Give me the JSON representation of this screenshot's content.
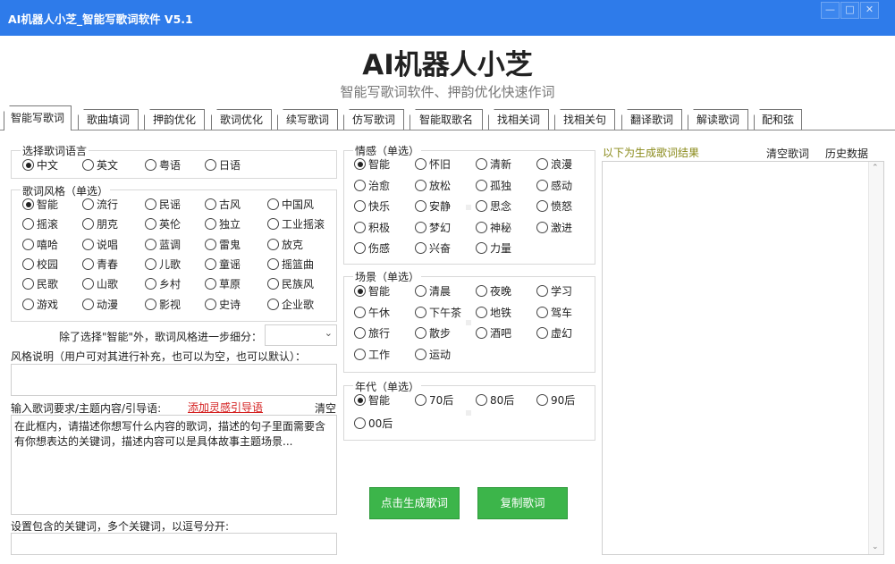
{
  "window": {
    "title": "AI机器人小芝_智能写歌词软件 V5.1",
    "min": "—",
    "max": "□",
    "close": "✕"
  },
  "header": {
    "title": "AI机器人小芝",
    "subtitle": "智能写歌词软件、押韵优化快速作词"
  },
  "tabs": [
    "智能写歌词",
    "歌曲填词",
    "押韵优化",
    "歌词优化",
    "续写歌词",
    "仿写歌词",
    "智能取歌名",
    "找相关词",
    "找相关句",
    "翻译歌词",
    "解读歌词",
    "配和弦"
  ],
  "language": {
    "label": "选择歌词语言",
    "options": [
      "中文",
      "英文",
      "粤语",
      "日语"
    ],
    "selected": 0
  },
  "style": {
    "label": "歌词风格（单选）",
    "selected": 0,
    "options": [
      "智能",
      "流行",
      "民谣",
      "古风",
      "中国风",
      "摇滚",
      "朋克",
      "英伦",
      "独立",
      "工业摇滚",
      "嘻哈",
      "说唱",
      "蓝调",
      "雷鬼",
      "放克",
      "校园",
      "青春",
      "儿歌",
      "童谣",
      "摇篮曲",
      "民歌",
      "山歌",
      "乡村",
      "草原",
      "民族风",
      "游戏",
      "动漫",
      "影视",
      "史诗",
      "企业歌"
    ]
  },
  "refine": {
    "label": "除了选择\"智能\"外，歌词风格进一步细分：",
    "value": ""
  },
  "style_note": {
    "label": "风格说明（用户可对其进行补充，也可以为空，也可以默认）：",
    "value": ""
  },
  "requirement": {
    "label": "输入歌词要求/主题内容/引导语:",
    "link": "添加灵感引导语",
    "clear": "清空",
    "placeholder": "在此框内，请描述你想写什么内容的歌词，描述的句子里面需要含有你想表达的关键词，描述内容可以是具体故事主题场景..."
  },
  "keywords": {
    "label": "设置包含的关键词，多个关键词，以逗号分开:",
    "value": ""
  },
  "emotion": {
    "label": "情感（单选）",
    "selected": 0,
    "options": [
      "智能",
      "怀旧",
      "清新",
      "浪漫",
      "治愈",
      "放松",
      "孤独",
      "感动",
      "快乐",
      "安静",
      "思念",
      "愤怒",
      "积极",
      "梦幻",
      "神秘",
      "激进",
      "伤感",
      "兴奋",
      "力量"
    ]
  },
  "scene": {
    "label": "场景（单选）",
    "selected": 0,
    "options": [
      "智能",
      "清晨",
      "夜晚",
      "学习",
      "午休",
      "下午茶",
      "地铁",
      "驾车",
      "旅行",
      "散步",
      "酒吧",
      "虚幻",
      "工作",
      "运动"
    ]
  },
  "era": {
    "label": "年代（单选）",
    "selected": 0,
    "options": [
      "智能",
      "70后",
      "80后",
      "90后",
      "00后"
    ]
  },
  "buttons": {
    "generate": "点击生成歌词",
    "copy": "复制歌词"
  },
  "result": {
    "label": "以下为生成歌词结果",
    "clear": "清空歌词",
    "history": "历史数据",
    "value": ""
  },
  "colors": {
    "titlebar": "#2E7BEA",
    "button": "#3CB54A",
    "result_label": "#8A8A1A",
    "link": "#D42020"
  }
}
